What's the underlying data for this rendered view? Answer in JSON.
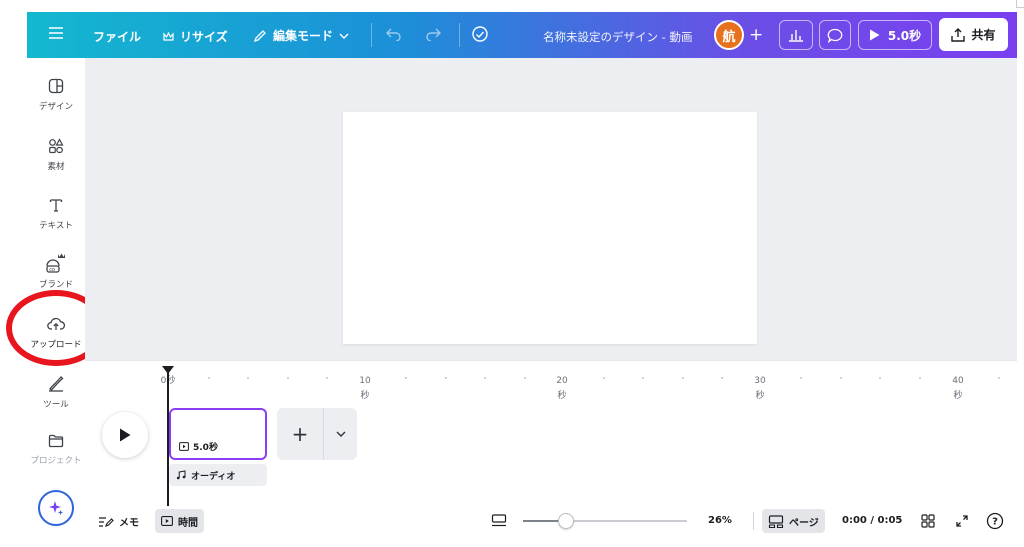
{
  "topbar": {
    "file_label": "ファイル",
    "resize_label": "リサイズ",
    "edit_mode_label": "編集モード",
    "design_title": "名称未設定のデザイン - 動画",
    "avatar_initial": "航",
    "play_label": "5.0秒",
    "share_label": "共有"
  },
  "sidebar": {
    "items": [
      {
        "label": "デザイン",
        "icon": "layout-icon"
      },
      {
        "label": "素材",
        "icon": "shapes-icon"
      },
      {
        "label": "テキスト",
        "icon": "text-icon"
      },
      {
        "label": "ブランド",
        "icon": "brand-icon"
      },
      {
        "label": "アップロード",
        "icon": "cloud-upload-icon"
      },
      {
        "label": "ツール",
        "icon": "tools-icon"
      },
      {
        "label": "プロジェクト",
        "icon": "folder-icon"
      }
    ]
  },
  "timeline": {
    "ticks": [
      {
        "value": "0",
        "unit": "秒"
      },
      {
        "value": "10",
        "unit": "秒"
      },
      {
        "value": "20",
        "unit": "秒"
      },
      {
        "value": "30",
        "unit": "秒"
      },
      {
        "value": "40",
        "unit": "秒"
      }
    ],
    "clip_duration": "5.0秒",
    "audio_label": "オーディオ"
  },
  "bottombar": {
    "notes_label": "メモ",
    "time_label": "時間",
    "zoom": "26%",
    "zoom_fraction": 0.26,
    "pages_label": "ページ",
    "time_display": "0:00 / 0:05",
    "help_symbol": "?"
  },
  "colors": {
    "accent_purple": "#8b3ef5",
    "highlight_red": "#e8141e",
    "avatar_orange": "#e8711d"
  }
}
